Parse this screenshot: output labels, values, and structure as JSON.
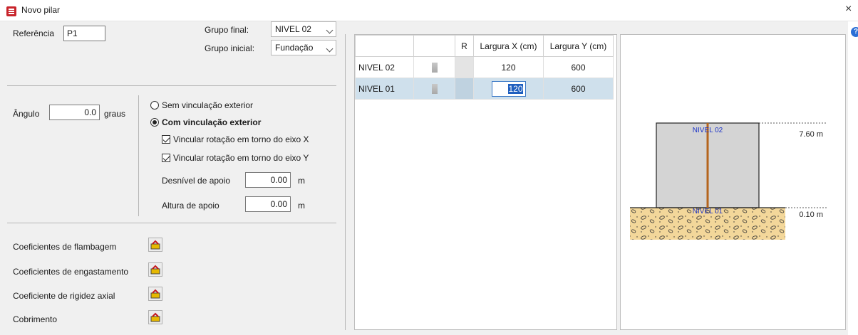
{
  "window": {
    "title": "Novo pilar",
    "close_glyph": "×",
    "help_glyph": "?"
  },
  "header": {
    "referencia_label": "Referência",
    "referencia_value": "P1",
    "grupo_final_label": "Grupo final:",
    "grupo_final_value": "NIVEL 02",
    "grupo_inicial_label": "Grupo inicial:",
    "grupo_inicial_value": "Fundação"
  },
  "angle": {
    "label": "Ângulo",
    "value": "0.0",
    "unit": "graus"
  },
  "vinculacao": {
    "sem_label": "Sem vinculação exterior",
    "sem_selected": false,
    "com_label": "Com vinculação exterior",
    "com_selected": true,
    "rot_x_label": "Vincular rotação em torno do eixo X",
    "rot_x_checked": true,
    "rot_y_label": "Vincular rotação em torno do eixo Y",
    "rot_y_checked": true,
    "desnivel_label": "Desnível de apoio",
    "desnivel_value": "0.00",
    "desnivel_unit": "m",
    "altura_label": "Altura de apoio",
    "altura_value": "0.00",
    "altura_unit": "m"
  },
  "coefficients": {
    "flambagem": "Coeficientes de flambagem",
    "engastamento": "Coeficientes de engastamento",
    "rigidez": "Coeficiente de rigidez axial",
    "cobrimento": "Cobrimento",
    "edit_icon": "edit-pencil-icon"
  },
  "grid": {
    "headers": [
      "",
      "",
      "R",
      "Largura X (cm)",
      "Largura Y (cm)"
    ],
    "rows": [
      {
        "name": "NIVEL 02",
        "largura_x": "120",
        "largura_y": "600",
        "selected": false
      },
      {
        "name": "NIVEL 01",
        "largura_x": "120",
        "largura_y": "600",
        "selected": true
      }
    ]
  },
  "preview": {
    "top_level_label": "NIVEL 02",
    "bottom_level_label": "NIVEL 01",
    "top_elevation": "7.60 m",
    "bottom_elevation": "0.10 m",
    "column_color": "#b5651d",
    "soil_color": "#f3d79a"
  }
}
